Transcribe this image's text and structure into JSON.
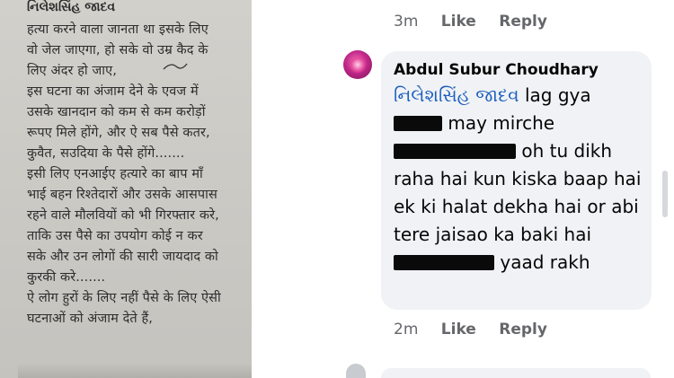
{
  "left_note": {
    "author": "નિલેશસિંહ જાદવ",
    "lines": [
      "हत्या करने वाला जानता था इसके लिए",
      "वो जेल जाएगा, हो सके वो उम्र कैद के",
      "लिए अंदर हो जाए,",
      "इस घटना का अंजाम देने के एवज में",
      "उसके खानदान को कम से कम करोड़ों",
      "रूपए मिले होंगे, और ऐ सब पैसे कतर,",
      "कुवैत, सउदिया के पैसे होंगे.......",
      "इसी लिए एनआईए हत्यारे का बाप माँ",
      "भाई बहन रिश्तेदारों और उसके आसपास",
      "रहने वाले मौलवियों को भी गिरफ्तार करे,",
      "ताकि उस पैसे का उपयोग कोई न कर",
      "सके और उन लोगों की सारी जायदाद को",
      "कुरकी करे.......",
      "ऐ लोग हुरों के लिए नहीं पैसे के लिए ऐसी",
      "घटनाओं को अंजाम देते हैं,"
    ]
  },
  "comment": {
    "top_actions": {
      "time": "3m",
      "like": "Like",
      "reply": "Reply"
    },
    "commenter": "Abdul Subur Choudhary",
    "mention": "નિલેશસિંહ જાદવ",
    "text_1": " lag gya",
    "text_2": " may mirche",
    "text_3": " oh tu dikh raha hai kun kiska baap hai ek ki halat dekha hai or abi tere jaisao ka baki hai",
    "text_4": " yaad rakh",
    "bottom_actions": {
      "time": "2m",
      "like": "Like",
      "reply": "Reply"
    }
  },
  "icons": {
    "avatar": "avatar-flower-icon"
  },
  "colors": {
    "mention": "#1d5fbf",
    "bubble": "#f0f2f5",
    "meta": "#65676b"
  }
}
